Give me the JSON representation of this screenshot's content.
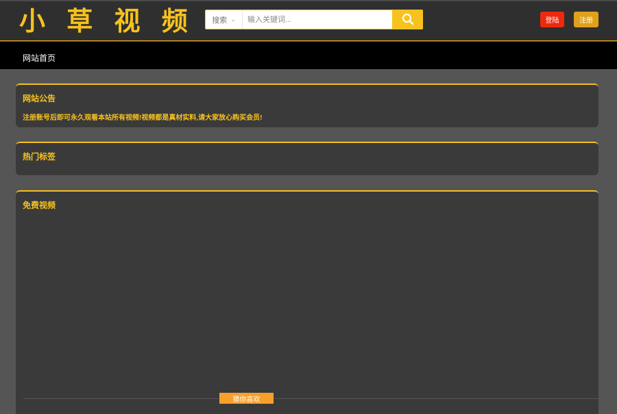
{
  "header": {
    "logo": "小 草 视 频",
    "search": {
      "type_label": "搜索",
      "placeholder": "输入关键词..."
    },
    "login_label": "登陆",
    "register_label": "注册"
  },
  "nav": {
    "items": [
      {
        "label": "网站首页"
      }
    ]
  },
  "announcement": {
    "title": "网站公告",
    "text": "注册账号后即可永久观看本站所有视频!视频都是真材实料,请大家放心购买会员!"
  },
  "hot_tags": {
    "title": "热门标签"
  },
  "free_videos": {
    "title": "免费视频"
  },
  "recommend": {
    "tab_label": "猜你喜欢"
  },
  "colors": {
    "accent": "#f7c21d",
    "header_bg": "#2f2f2f",
    "nav_bg": "#000000",
    "panel_bg": "#3a3a3a",
    "page_bg": "#555555",
    "login_bg": "#f0280e",
    "register_bg": "#e0a11a",
    "tab_bg": "#f7a02c"
  }
}
